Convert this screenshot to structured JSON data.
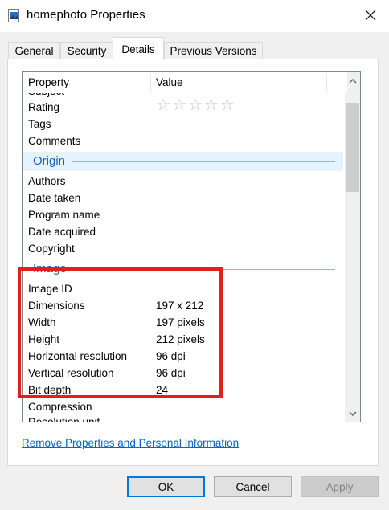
{
  "window": {
    "title": "homephoto Properties"
  },
  "tabs": [
    {
      "label": "General"
    },
    {
      "label": "Security"
    },
    {
      "label": "Details",
      "active": true
    },
    {
      "label": "Previous Versions"
    }
  ],
  "list": {
    "headers": {
      "property": "Property",
      "value": "Value"
    },
    "partial_top": "Subject",
    "rating_label": "Rating",
    "rating_stars": "☆☆☆☆☆",
    "rating_value": 0,
    "tags_label": "Tags",
    "comments_label": "Comments",
    "origin_group": "Origin",
    "origin_rows": [
      {
        "label": "Authors",
        "value": ""
      },
      {
        "label": "Date taken",
        "value": ""
      },
      {
        "label": "Program name",
        "value": ""
      },
      {
        "label": "Date acquired",
        "value": ""
      },
      {
        "label": "Copyright",
        "value": ""
      }
    ],
    "image_group": "Image",
    "image_rows": [
      {
        "label": "Image ID",
        "value": ""
      },
      {
        "label": "Dimensions",
        "value": "197 x 212"
      },
      {
        "label": "Width",
        "value": "197 pixels"
      },
      {
        "label": "Height",
        "value": "212 pixels"
      },
      {
        "label": "Horizontal resolution",
        "value": "96 dpi"
      },
      {
        "label": "Vertical resolution",
        "value": "96 dpi"
      },
      {
        "label": "Bit depth",
        "value": "24"
      },
      {
        "label": "Compression",
        "value": ""
      }
    ],
    "partial_bottom": "Resolution unit"
  },
  "link": {
    "label": "Remove Properties and Personal Information"
  },
  "buttons": {
    "ok": "OK",
    "cancel": "Cancel",
    "apply": "Apply"
  },
  "colors": {
    "highlight": "#e0201e",
    "link": "#0066cc",
    "group_header": "#1e5bb8"
  }
}
